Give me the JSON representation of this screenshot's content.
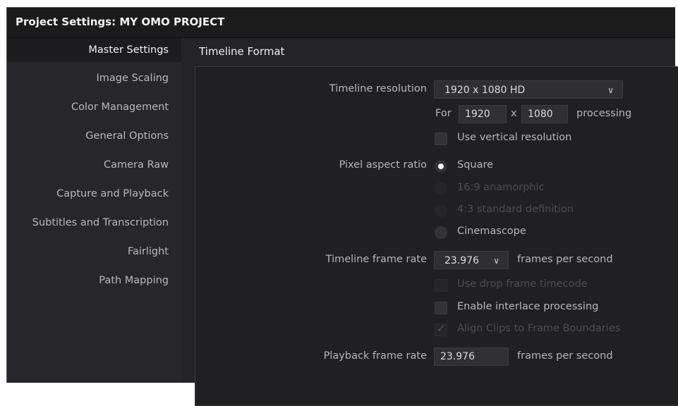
{
  "window": {
    "title": "Project Settings:  MY OMO PROJECT"
  },
  "sidebar": {
    "items": [
      {
        "label": "Master Settings"
      },
      {
        "label": "Image Scaling"
      },
      {
        "label": "Color Management"
      },
      {
        "label": "General Options"
      },
      {
        "label": "Camera Raw"
      },
      {
        "label": "Capture and Playback"
      },
      {
        "label": "Subtitles and Transcription"
      },
      {
        "label": "Fairlight"
      },
      {
        "label": "Path Mapping"
      }
    ],
    "active_index": 0
  },
  "main": {
    "section_title": "Timeline Format",
    "timeline_resolution": {
      "label": "Timeline resolution",
      "value": "1920 x 1080 HD",
      "for_label": "For",
      "width": "1920",
      "x_label": "x",
      "height": "1080",
      "processing_label": "processing",
      "vertical_label": "Use vertical resolution",
      "vertical_checked": false
    },
    "pixel_aspect_ratio": {
      "label": "Pixel aspect ratio",
      "options": [
        {
          "label": "Square",
          "selected": true,
          "enabled": true
        },
        {
          "label": "16:9 anamorphic",
          "selected": false,
          "enabled": false
        },
        {
          "label": "4:3 standard definition",
          "selected": false,
          "enabled": false
        },
        {
          "label": "Cinemascope",
          "selected": false,
          "enabled": true
        }
      ]
    },
    "timeline_frame_rate": {
      "label": "Timeline frame rate",
      "value": "23.976",
      "unit": "frames per second",
      "drop_frame_label": "Use drop frame timecode",
      "drop_frame_enabled": false,
      "interlace_label": "Enable interlace processing",
      "interlace_checked": false,
      "align_label": "Align Clips to Frame Boundaries",
      "align_checked": true,
      "align_enabled": false
    },
    "playback_frame_rate": {
      "label": "Playback frame rate",
      "value": "23.976",
      "unit": "frames per second"
    }
  },
  "icons": {
    "dropdown": "chevron-down-icon",
    "check": "checkmark-icon"
  },
  "colors": {
    "window_bg": "#242426",
    "titlebar_bg": "#1b1b1c",
    "selected_sidebar_bg": "#1c1c1e",
    "text": "#cfcfcf"
  }
}
